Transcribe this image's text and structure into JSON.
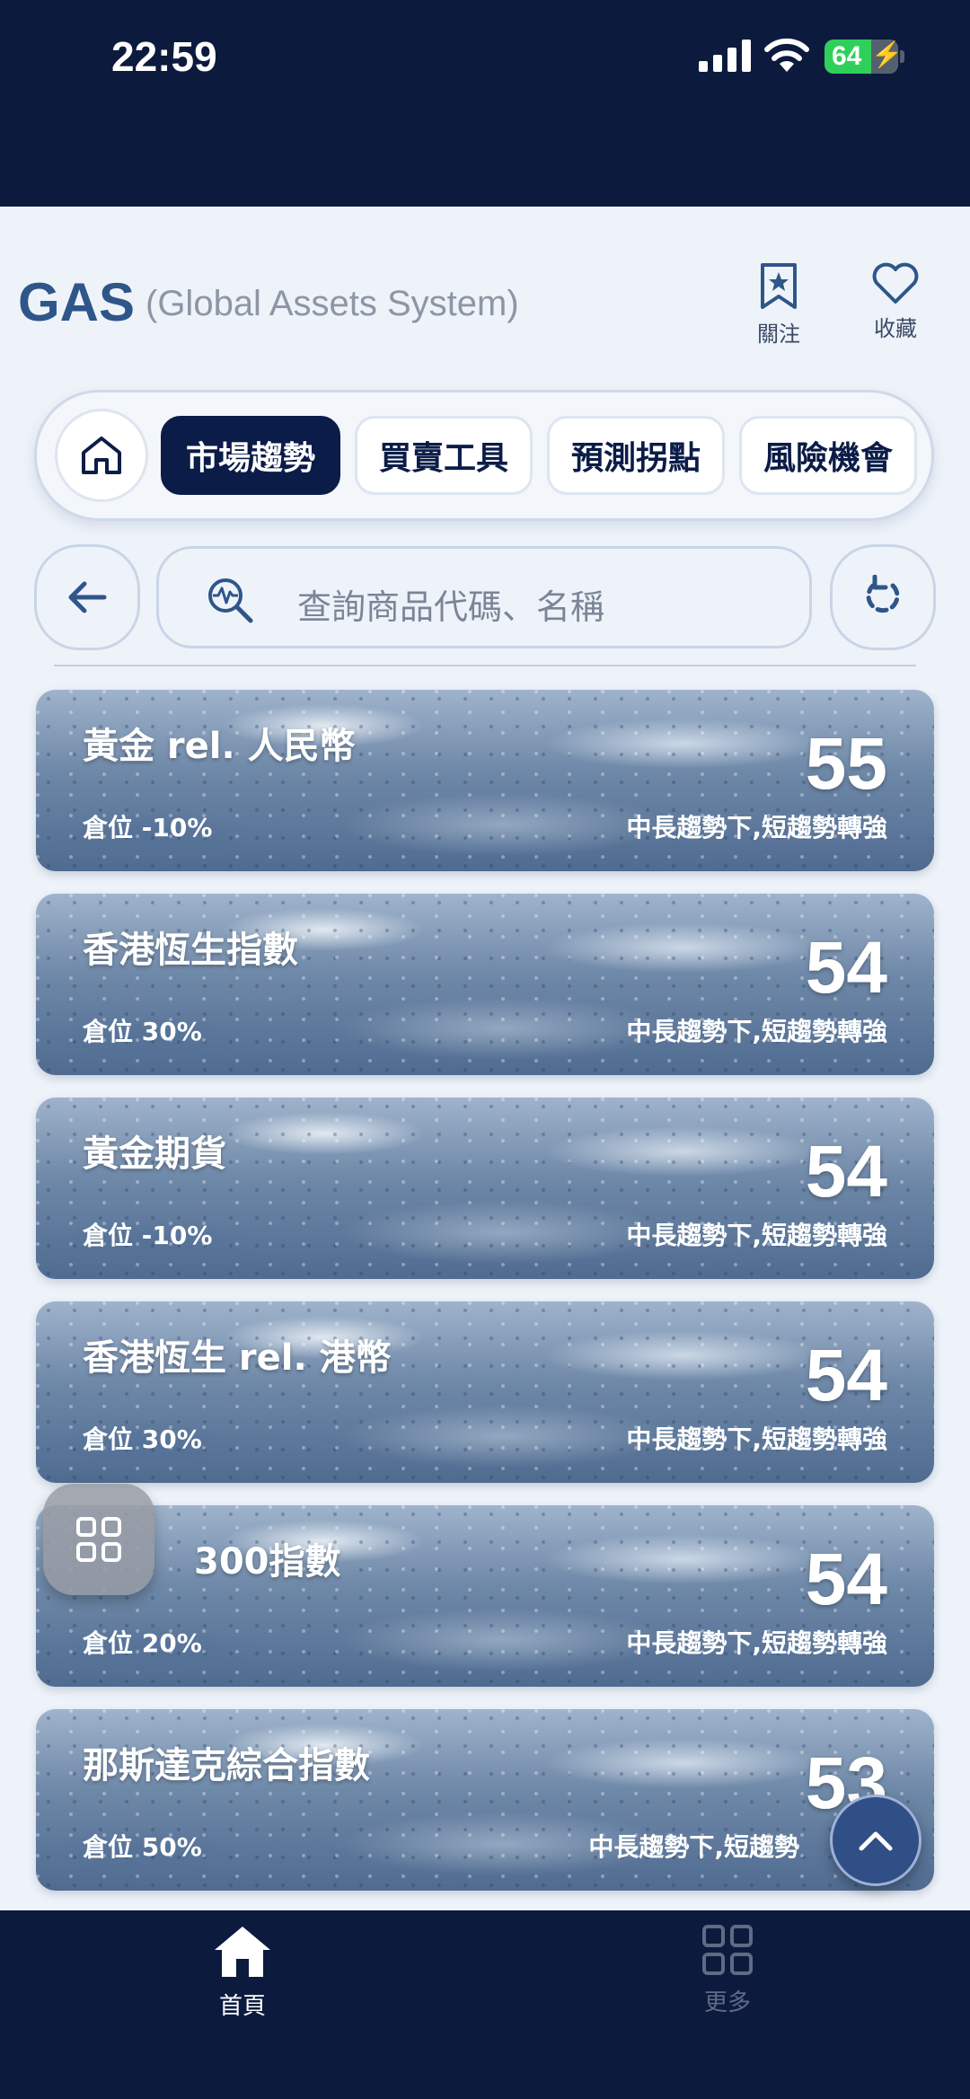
{
  "status_bar": {
    "time": "22:59",
    "battery": "64"
  },
  "header": {
    "logo": "GAS",
    "subtitle": "(Global Assets System)",
    "watch_label": "關注",
    "favorite_label": "收藏"
  },
  "tabs": [
    {
      "label": "市場趨勢",
      "active": true
    },
    {
      "label": "買賣工具",
      "active": false
    },
    {
      "label": "預測拐點",
      "active": false
    },
    {
      "label": "風險機會",
      "active": false
    }
  ],
  "search": {
    "placeholder": "查詢商品代碼、名稱"
  },
  "cards": [
    {
      "name": "黃金 rel. 人民幣",
      "score": "55",
      "position": "倉位 -10%",
      "trend": "中長趨勢下,短趨勢轉強"
    },
    {
      "name": "香港恆生指數",
      "score": "54",
      "position": "倉位 30%",
      "trend": "中長趨勢下,短趨勢轉強"
    },
    {
      "name": "黃金期貨",
      "score": "54",
      "position": "倉位 -10%",
      "trend": "中長趨勢下,短趨勢轉強"
    },
    {
      "name": "香港恆生 rel. 港幣",
      "score": "54",
      "position": "倉位 30%",
      "trend": "中長趨勢下,短趨勢轉強"
    },
    {
      "name": "300指數",
      "score": "54",
      "position": "倉位 20%",
      "trend": "中長趨勢下,短趨勢轉強"
    },
    {
      "name": "那斯達克綜合指數",
      "score": "53",
      "position": "倉位 50%",
      "trend": "中長趨勢下,短趨勢"
    }
  ],
  "bottom_nav": {
    "home_label": "首頁",
    "more_label": "更多"
  },
  "colors": {
    "navy": "#0c1a3e",
    "active_tab": "#0b1c48",
    "logo": "#2f5689"
  }
}
